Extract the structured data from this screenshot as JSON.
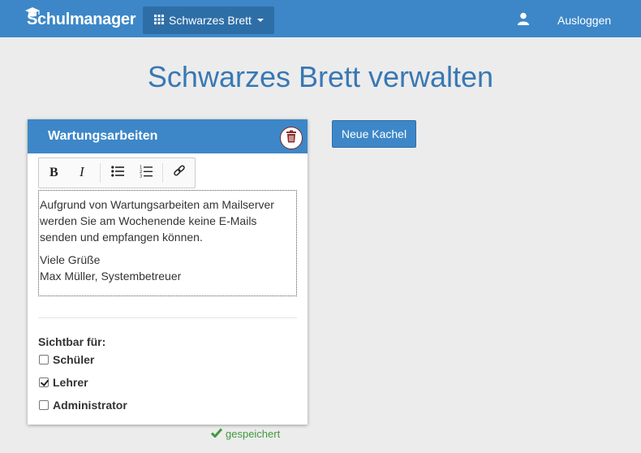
{
  "navbar": {
    "brand": "Schulmanager",
    "dropdown_label": "Schwarzes Brett",
    "logout_label": "Ausloggen",
    "icons": [
      "graduation-cap-icon",
      "grid-icon",
      "caret-down-icon",
      "user-icon"
    ]
  },
  "page": {
    "title": "Schwarzes Brett verwalten"
  },
  "tile": {
    "title": "Wartungsarbeiten",
    "toolbar": [
      "bold",
      "italic",
      "bullet-list",
      "numbered-list",
      "link"
    ],
    "content": {
      "paragraph1": "Aufgrund von Wartungsarbeiten am Mailserver werden Sie am Wochenende keine E-Mails senden und empfangen können.",
      "greeting": "Viele Grüße",
      "signature": "Max Müller, Systembetreuer"
    },
    "visibility": {
      "label": "Sichtbar für:",
      "options": [
        {
          "label": "Schüler",
          "checked": false
        },
        {
          "label": "Lehrer",
          "checked": true
        },
        {
          "label": "Administrator",
          "checked": false
        }
      ]
    }
  },
  "actions": {
    "new_tile_label": "Neue Kachel"
  },
  "status": {
    "saved_label": "gespeichert"
  },
  "colors": {
    "primary": "#3d87c8",
    "primary_dark": "#2e6ea7",
    "title": "#3978b4",
    "success": "#3f9a3f",
    "delete": "#7b2a2a",
    "background": "#ececec"
  }
}
